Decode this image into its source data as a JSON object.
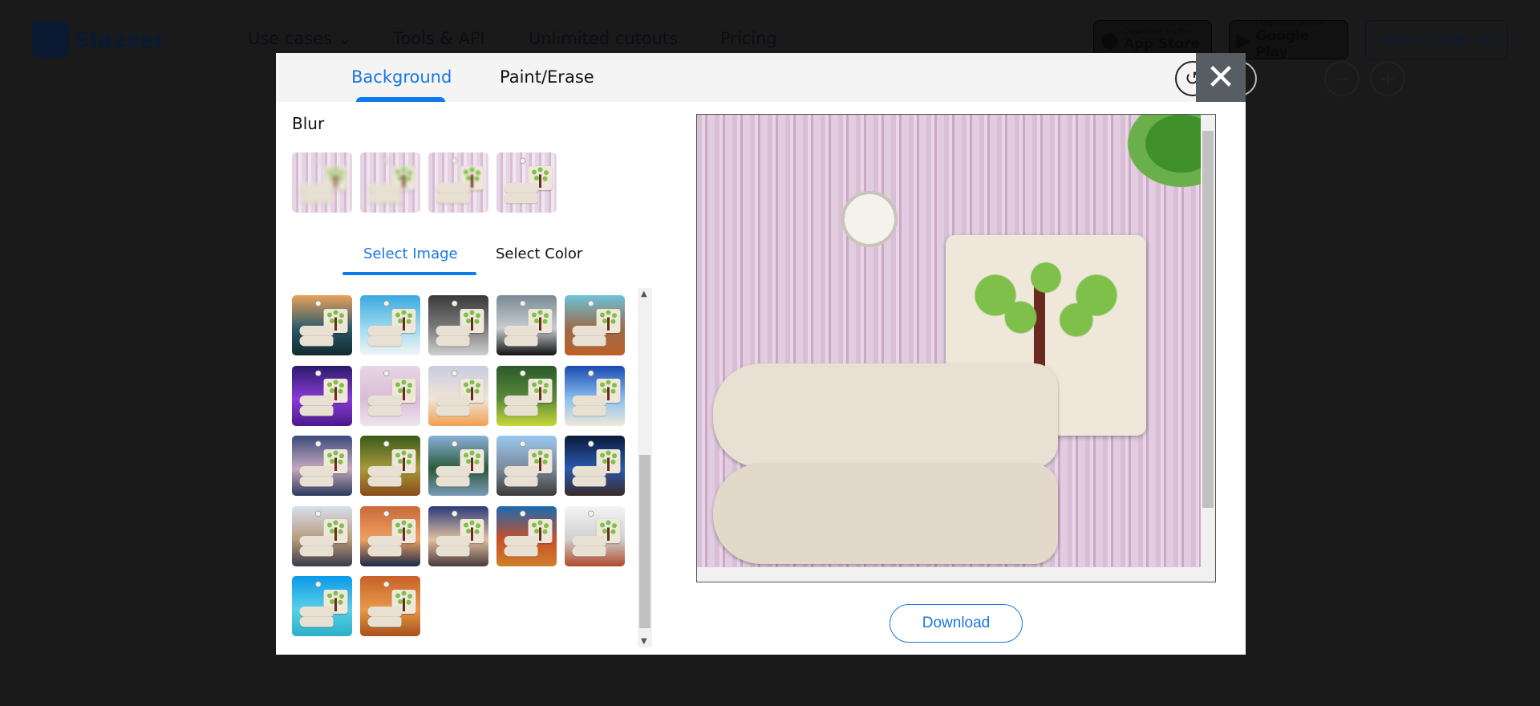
{
  "nav": {
    "logo": "Slazzer",
    "items": [
      "Use cases ⌄",
      "Tools & API",
      "Unlimited cutouts",
      "Pricing"
    ],
    "app_store": {
      "line1": "Download on the",
      "line2": "App Store"
    },
    "google_play": {
      "line1": "Download on the",
      "line2": "Google Play"
    },
    "login": "Log in / Sign up"
  },
  "editor": {
    "tabs": [
      "Background",
      "Paint/Erase"
    ],
    "active_tab": "Background",
    "toolbar": {
      "undo": "undo-icon",
      "redo": "redo-icon",
      "zoom_out": "minus-icon",
      "zoom_in": "plus-icon",
      "close": "✕"
    },
    "blur_label": "Blur",
    "blur_levels": 4,
    "subtabs": [
      "Select Image",
      "Select Color"
    ],
    "active_subtab": "Select Image",
    "backgrounds": [
      [
        "#e9a15a",
        "#2c5a6a",
        "#0f2a2e"
      ],
      [
        "#3aa9e0",
        "#9fdaf0",
        "#f4f4f4"
      ],
      [
        "#3a3a3a",
        "#7d7d7d",
        "#d0d0d0"
      ],
      [
        "#7a8a96",
        "#c8ccd0",
        "#111"
      ],
      [
        "#6cc3d8",
        "#9a6a4a",
        "#c0602a"
      ],
      [
        "#2b1a6a",
        "#8a3ad8",
        "#4a1a8a"
      ],
      [
        "#e8d6e6",
        "#d8bcd6",
        "#efe4ee"
      ],
      [
        "#c8cce0",
        "#f0e4d8",
        "#f0a050"
      ],
      [
        "#2a5a2a",
        "#5a8a3a",
        "#c8d83a"
      ],
      [
        "#1a4ab0",
        "#8ac0f0",
        "#f0e8d8"
      ],
      [
        "#3a4a7a",
        "#c8a8c0",
        "#2a3a5a"
      ],
      [
        "#3a5a1a",
        "#a89a3a",
        "#8a4a1a"
      ],
      [
        "#8ab0d8",
        "#2a5a3a",
        "#7a9ab8"
      ],
      [
        "#9ac8f0",
        "#7a8a9a",
        "#3a3a3a"
      ],
      [
        "#0a1a3a",
        "#2a5ab0",
        "#3a2a2a"
      ],
      [
        "#d8e0f0",
        "#b89a7a",
        "#3a3a4a"
      ],
      [
        "#c86a3a",
        "#f0a060",
        "#1a2a4a"
      ],
      [
        "#2a3a7a",
        "#e0c0a0",
        "#4a3a3a"
      ],
      [
        "#1a6ab0",
        "#c8502a",
        "#d0802a"
      ],
      [
        "#f4f4f4",
        "#d0d0d0",
        "#b04a2a"
      ],
      [
        "#0a9ae8",
        "#5ad0e8",
        "#2ab0c8"
      ],
      [
        "#c8602a",
        "#e89a4a",
        "#a8501a"
      ]
    ],
    "download": "Download"
  },
  "colors": {
    "accent": "#1976e0",
    "close_bg": "#575d62"
  }
}
